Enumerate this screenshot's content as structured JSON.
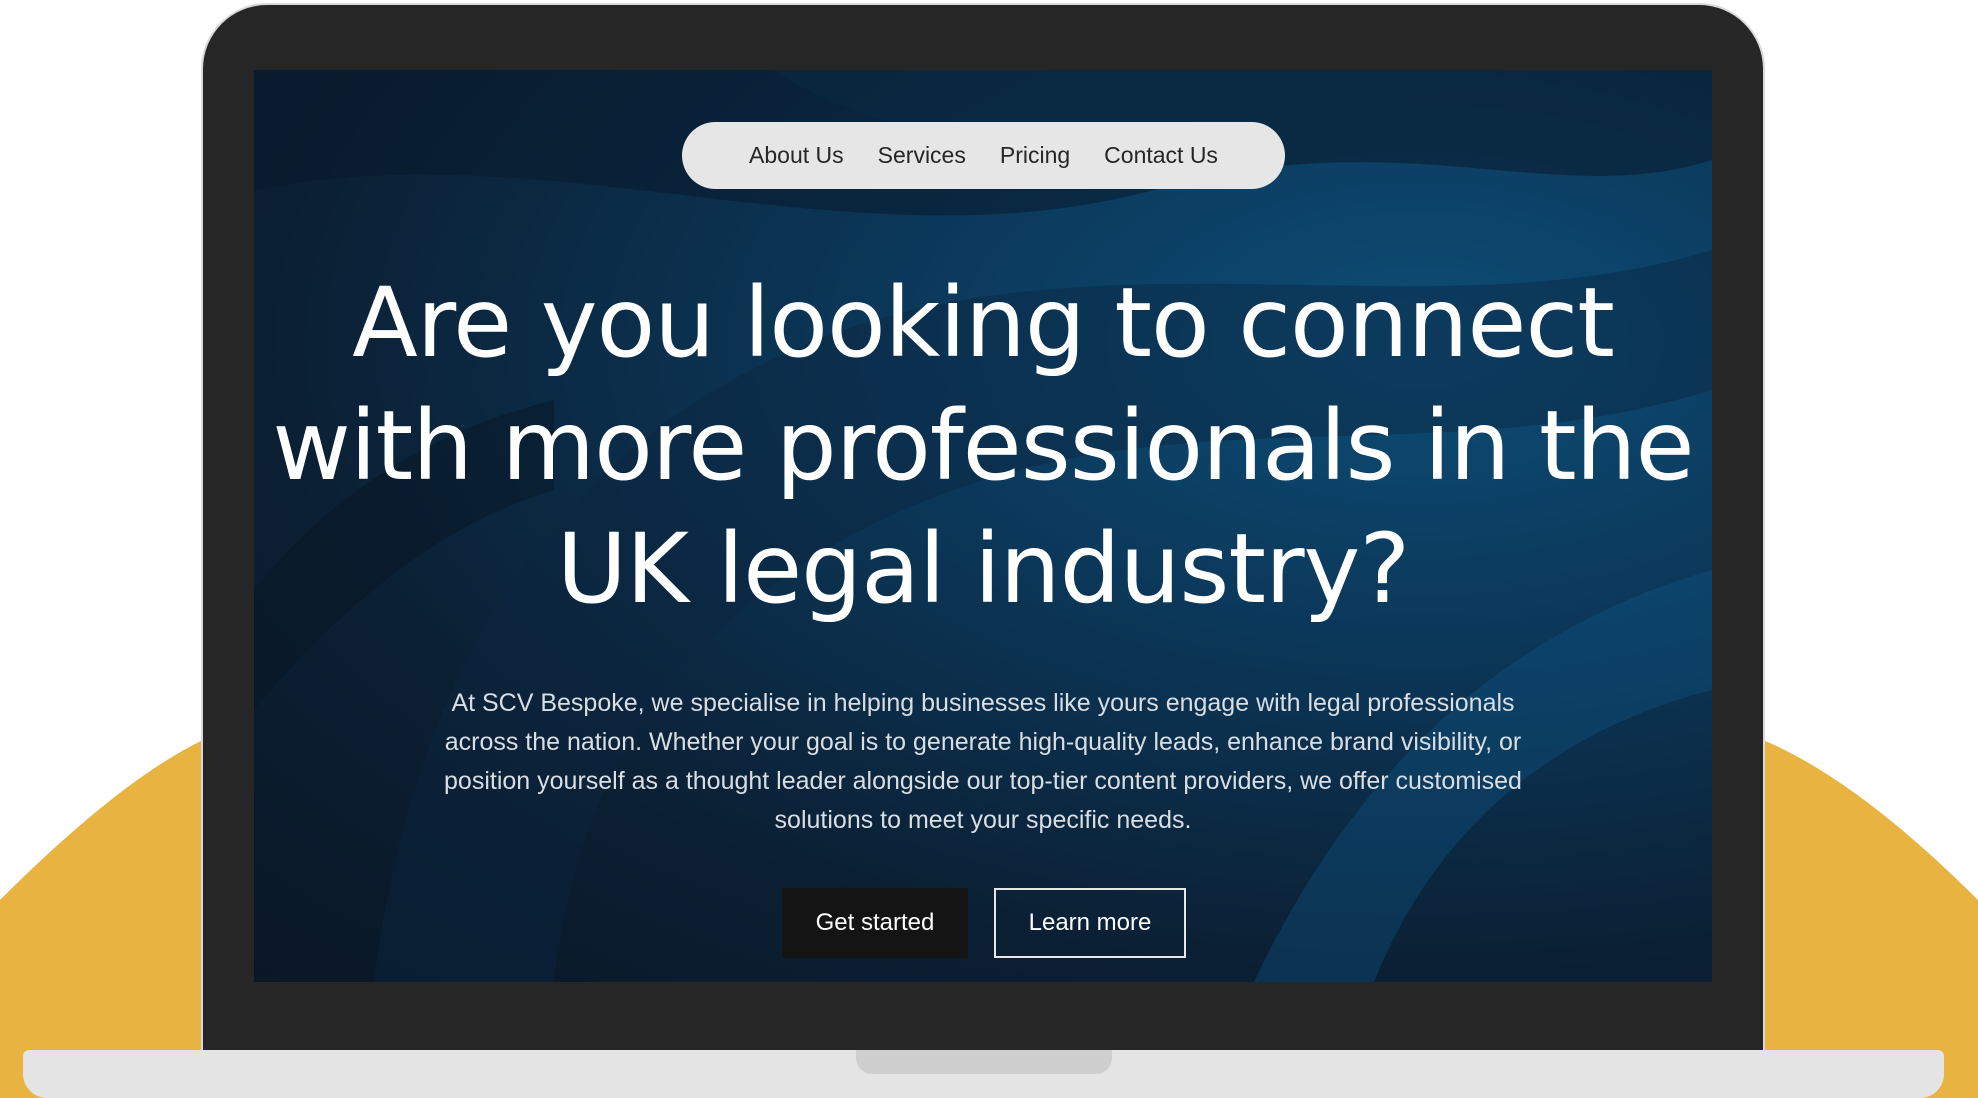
{
  "colors": {
    "accent_background": "#e8b340",
    "laptop_frame": "#262626",
    "screen_dark": "#0b1f33",
    "screen_blue": "#0d4d77",
    "nav_background": "#e6e6e6",
    "button_primary": "#141414"
  },
  "navbar": {
    "items": [
      {
        "label": "About Us"
      },
      {
        "label": "Services"
      },
      {
        "label": "Pricing"
      },
      {
        "label": "Contact Us"
      }
    ]
  },
  "hero": {
    "headline_lines": [
      "Are you looking to connect",
      "with more professionals in the",
      "UK legal industry?"
    ],
    "description_lines": [
      "At SCV Bespoke, we specialise in helping businesses like yours engage with legal professionals",
      "across the nation. Whether your goal is to generate high-quality leads, enhance brand visibility, or",
      "position yourself as a thought leader alongside our top-tier content providers, we offer customised",
      "solutions to meet your specific needs."
    ],
    "primary_button": "Get started",
    "secondary_button": "Learn more"
  }
}
